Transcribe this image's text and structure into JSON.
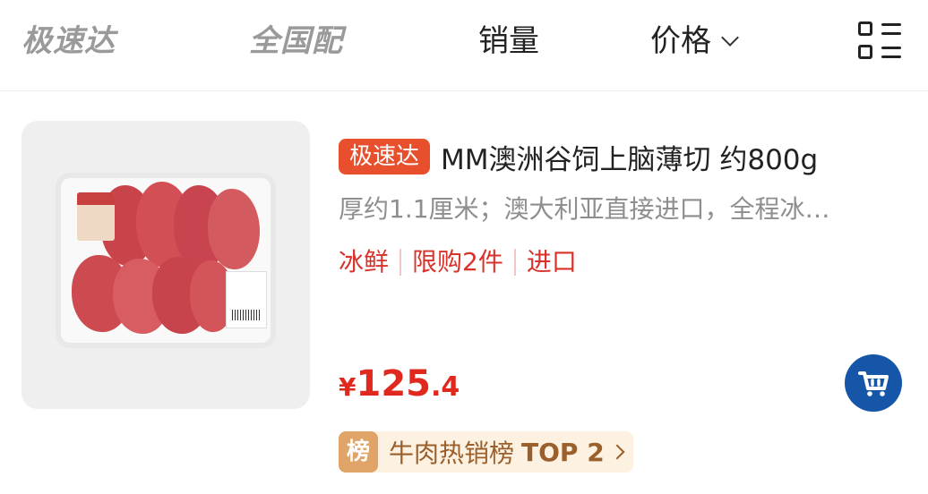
{
  "filter_bar": {
    "brand_fast": "极速达",
    "brand_national": "全国配",
    "sales": "销量",
    "price": "价格"
  },
  "product": {
    "badge": "极速达",
    "title": "MM澳洲谷饲上脑薄切 约800g",
    "description": "厚约1.1厘米；澳大利亚直接进口，全程冰…",
    "tags": [
      "冰鲜",
      "限购2件",
      "进口"
    ],
    "price": {
      "currency": "¥",
      "integer": "125",
      "decimal": ".4"
    },
    "rank": {
      "badge": "榜",
      "text": "牛肉热销榜",
      "top": "TOP 2"
    }
  },
  "colors": {
    "accent_red": "#e0281e",
    "badge_orange": "#e8502d",
    "cart_blue": "#1556a8",
    "rank_bg": "#fdf1e2"
  },
  "icons": {
    "layout": "grid-list-icon",
    "chevron": "chevron-down-icon",
    "cart": "cart-icon",
    "rank_arrow": "chevron-right-icon"
  }
}
